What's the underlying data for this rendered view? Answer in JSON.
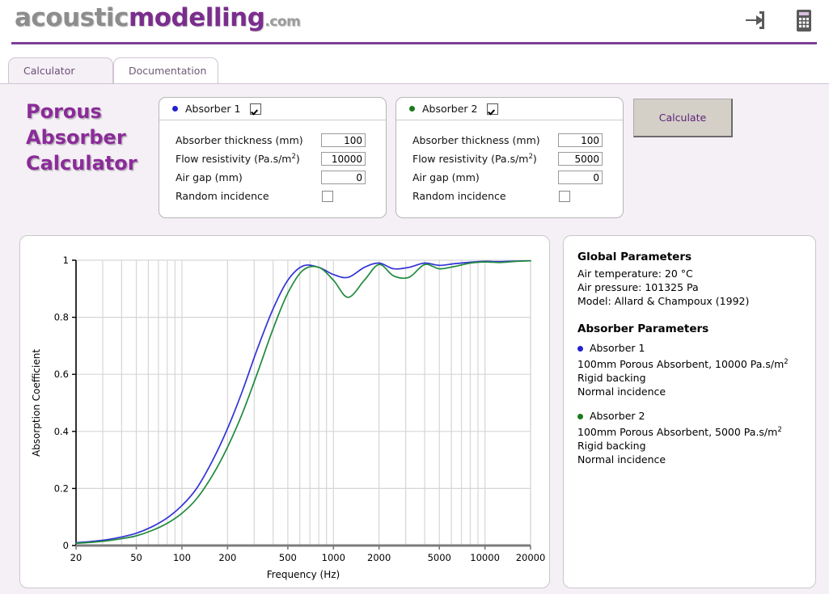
{
  "header": {
    "logo_part1": "acoustic",
    "logo_part2": "modelling",
    "logo_part3": ".com",
    "icons": [
      {
        "name": "login-icon",
        "label": "Login"
      },
      {
        "name": "calculator-icon",
        "label": "Calculator"
      }
    ],
    "rule_color": "#7b3f98"
  },
  "tabs": [
    {
      "label": "Calculator",
      "active": true
    },
    {
      "label": "Documentation",
      "active": false
    }
  ],
  "page_title": "Porous\nAbsorber\nCalculator",
  "page_title_lines": [
    "Porous",
    "Absorber",
    "Calculator"
  ],
  "absorbers": [
    {
      "title": "Absorber 1",
      "color": "#2222cc",
      "enabled": true,
      "fields": [
        {
          "label": "Absorber thickness (mm)",
          "value": "100",
          "type": "text"
        },
        {
          "label": "Flow resistivity (Pa.s/m²)",
          "label_base": "Flow resistivity (Pa.s/m",
          "label_sup": "2",
          "label_tail": ")",
          "value": "10000",
          "type": "text"
        },
        {
          "label": "Air gap (mm)",
          "value": "0",
          "type": "text"
        },
        {
          "label": "Random incidence",
          "value": "",
          "checked": false,
          "type": "checkbox"
        }
      ]
    },
    {
      "title": "Absorber 2",
      "color": "#1a7a1a",
      "enabled": true,
      "fields": [
        {
          "label": "Absorber thickness (mm)",
          "value": "100",
          "type": "text"
        },
        {
          "label": "Flow resistivity (Pa.s/m²)",
          "label_base": "Flow resistivity (Pa.s/m",
          "label_sup": "2",
          "label_tail": ")",
          "value": "5000",
          "type": "text"
        },
        {
          "label": "Air gap (mm)",
          "value": "0",
          "type": "text"
        },
        {
          "label": "Random incidence",
          "value": "",
          "checked": false,
          "type": "checkbox"
        }
      ]
    }
  ],
  "calculate_button": "Calculate",
  "params_panel": {
    "global_heading": "Global Parameters",
    "global_lines": [
      "Air temperature: 20 °C",
      "Air pressure: 101325 Pa",
      "Model: Allard & Champoux (1992)"
    ],
    "absorber_heading": "Absorber Parameters",
    "entries": [
      {
        "name": "Absorber 1",
        "color": "#2222cc",
        "line1_base": "100mm Porous Absorbent, 10000 Pa.s/m",
        "line1_sup": "2",
        "line2": "Rigid backing",
        "line3": "Normal incidence"
      },
      {
        "name": "Absorber 2",
        "color": "#1a7a1a",
        "line1_base": "100mm Porous Absorbent, 5000 Pa.s/m",
        "line1_sup": "2",
        "line2": "Rigid backing",
        "line3": "Normal incidence"
      }
    ]
  },
  "chart_data": {
    "type": "line",
    "title": "",
    "xlabel": "Frequency (Hz)",
    "ylabel": "Absorption Coefficient",
    "xscale": "log",
    "xlim": [
      20,
      20000
    ],
    "ylim": [
      0,
      1
    ],
    "yticks": [
      0,
      0.2,
      0.4,
      0.6,
      0.8,
      1
    ],
    "ytick_labels": [
      "0",
      "0.2",
      "0.4",
      "0.6",
      "0.8",
      "1"
    ],
    "xticks": [
      20,
      50,
      100,
      200,
      500,
      1000,
      2000,
      5000,
      10000,
      20000
    ],
    "xtick_labels": [
      "20",
      "50",
      "100",
      "200",
      "500",
      "1000",
      "2000",
      "5000",
      "10000",
      "20000"
    ],
    "grid": true,
    "grid_color": "#d6d6d6",
    "legend_position": "external",
    "series": [
      {
        "name": "Absorber 1",
        "color": "#3333d6",
        "x": [
          20,
          25,
          31.5,
          40,
          50,
          63,
          80,
          100,
          125,
          160,
          200,
          250,
          315,
          400,
          500,
          630,
          800,
          1000,
          1250,
          1600,
          2000,
          2500,
          3150,
          4000,
          5000,
          6300,
          8000,
          10000,
          12500,
          16000,
          20000
        ],
        "y": [
          0.01,
          0.014,
          0.02,
          0.03,
          0.043,
          0.065,
          0.097,
          0.14,
          0.2,
          0.3,
          0.41,
          0.54,
          0.69,
          0.83,
          0.93,
          0.98,
          0.975,
          0.95,
          0.94,
          0.975,
          0.99,
          0.97,
          0.975,
          0.99,
          0.982,
          0.988,
          0.993,
          0.996,
          0.995,
          0.997,
          0.998
        ]
      },
      {
        "name": "Absorber 2",
        "color": "#1f8a3b",
        "x": [
          20,
          25,
          31.5,
          40,
          50,
          63,
          80,
          100,
          125,
          160,
          200,
          250,
          315,
          400,
          500,
          630,
          800,
          1000,
          1250,
          1600,
          2000,
          2500,
          3150,
          4000,
          5000,
          6300,
          8000,
          10000,
          12500,
          16000,
          20000
        ],
        "y": [
          0.008,
          0.011,
          0.016,
          0.024,
          0.034,
          0.052,
          0.078,
          0.113,
          0.164,
          0.248,
          0.345,
          0.462,
          0.605,
          0.76,
          0.885,
          0.965,
          0.975,
          0.93,
          0.87,
          0.93,
          0.985,
          0.945,
          0.94,
          0.985,
          0.97,
          0.978,
          0.99,
          0.994,
          0.992,
          0.996,
          0.998
        ]
      }
    ]
  }
}
